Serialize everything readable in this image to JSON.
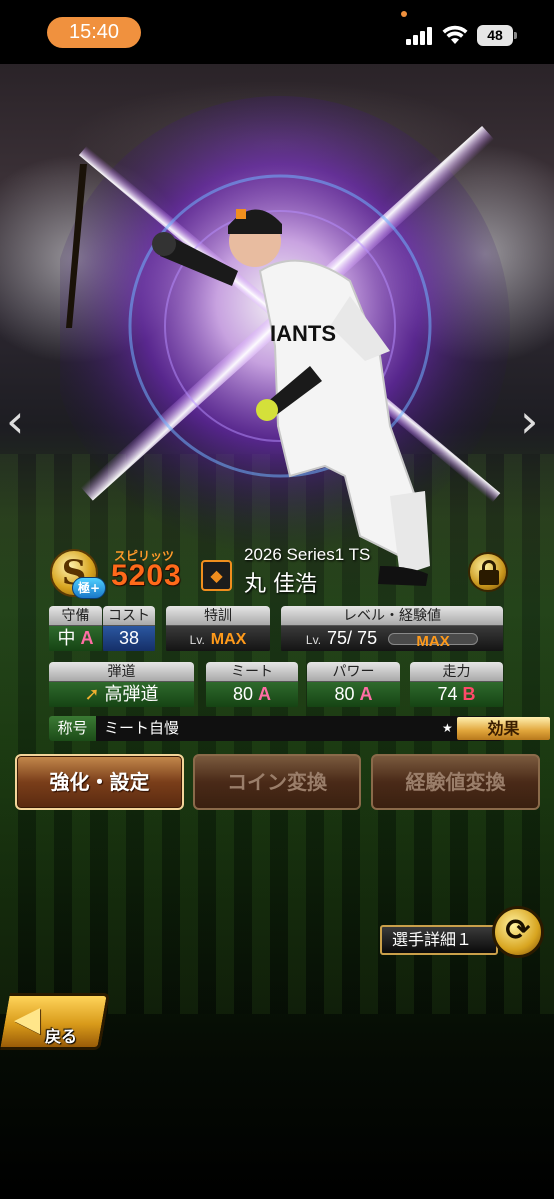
{
  "status_bar": {
    "time": "15:40",
    "battery": "48",
    "icons": [
      "signal-icon",
      "wifi-icon",
      "battery-icon"
    ]
  },
  "card": {
    "rank": "S",
    "rank_sub": "極+",
    "spirits_label": "スピリッツ",
    "spirits_value": "5203",
    "series": "2026 Series1 TS",
    "name": "丸 佳浩"
  },
  "stats": {
    "position": {
      "label": "守備",
      "value": "中",
      "grade": "A"
    },
    "cost": {
      "label": "コスト",
      "value": "38"
    },
    "training": {
      "label": "特訓",
      "lv": "Lv.",
      "value": "MAX"
    },
    "level": {
      "label": "レベル・経験値",
      "lv": "Lv.",
      "value": "75/ 75",
      "exp": "MAX"
    },
    "trajectory": {
      "label": "弾道",
      "value": "高弾道"
    },
    "meet": {
      "label": "ミート",
      "value": "80",
      "grade": "A"
    },
    "power": {
      "label": "パワー",
      "value": "80",
      "grade": "A"
    },
    "speed": {
      "label": "走力",
      "value": "74",
      "grade": "B"
    }
  },
  "title_row": {
    "tag": "称号",
    "value": "ミート自慢",
    "star": "★",
    "effect_button": "効果"
  },
  "actions": {
    "enhance": "強化・設定",
    "coin": "コイン変換",
    "exp": "経験値変換"
  },
  "details_button": "選手詳細１",
  "back_button": "戻る",
  "nav": {
    "prev": "‹",
    "next": "›"
  },
  "colors": {
    "accent": "#f0913e",
    "spirits": "#ff6a1a",
    "gold": "#d8a520"
  }
}
